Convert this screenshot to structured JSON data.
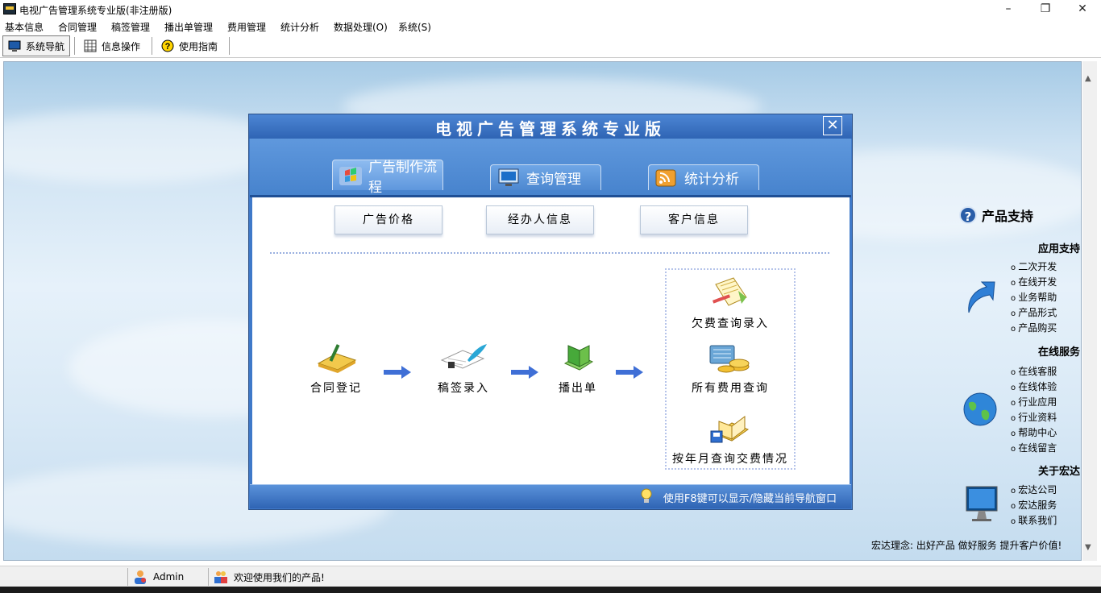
{
  "window": {
    "title": "电视广告管理系统专业版(非注册版)",
    "minimize": "–",
    "maximize": "❐",
    "close": "✕"
  },
  "menu": [
    "基本信息",
    "合同管理",
    "稿签管理",
    "播出单管理",
    "费用管理",
    "统计分析",
    "数据处理(O)",
    "系统(S)"
  ],
  "toolbar": {
    "nav": "系统导航",
    "info": "信息操作",
    "guide": "使用指南"
  },
  "dialog": {
    "title": "电视广告管理系统专业版",
    "close": "✕",
    "tabs": [
      "广告制作流程",
      "查询管理",
      "统计分析"
    ],
    "buttons": [
      "广告价格",
      "经办人信息",
      "客户信息"
    ],
    "flow": [
      "合同登记",
      "稿签录入",
      "播出单"
    ],
    "queries": [
      "欠费查询录入",
      "所有费用查询",
      "按年月查询交费情况"
    ],
    "hint": "使用F8键可以显示/隐藏当前导航窗口"
  },
  "side": {
    "title": "产品支持",
    "sections": [
      {
        "head": "应用支持",
        "items": [
          "二次开发",
          "在线开发",
          "业务帮助",
          "产品形式",
          "产品购买"
        ]
      },
      {
        "head": "在线服务",
        "items": [
          "在线客服",
          "在线体验",
          "行业应用",
          "行业资料",
          "帮助中心",
          "在线留言"
        ]
      },
      {
        "head": "关于宏达",
        "items": [
          "宏达公司",
          "宏达服务",
          "联系我们"
        ]
      }
    ],
    "motto": "宏达理念: 出好产品 做好服务 提升客户价值!"
  },
  "status": {
    "user": "Admin",
    "welcome": "欢迎使用我们的产品!"
  },
  "colors": {
    "dialog_blue": "#3f79c9",
    "flow_arrow": "#3f6fd6"
  }
}
